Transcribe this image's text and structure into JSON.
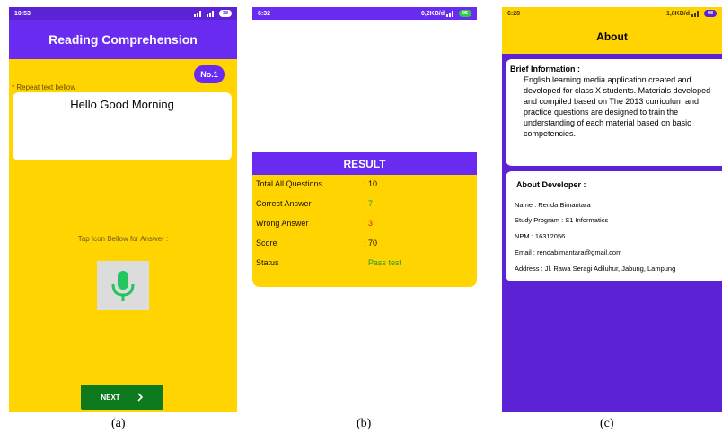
{
  "phone_a": {
    "status": {
      "time": "10:53",
      "battery": "38"
    },
    "title": "Reading Comprehension",
    "badge": "No.1",
    "hint": "* Repeat text bellow",
    "text": "Hello Good Morning",
    "tap_label": "Tap Icon Bellow for Answer :",
    "next_label": "NEXT",
    "icons": {
      "mic": "microphone-icon",
      "next": "chevron-right-icon"
    },
    "colors": {
      "accent": "#6a2bf0",
      "background": "#ffd400",
      "mic": "#22c55e",
      "next": "#0d7a1e"
    }
  },
  "phone_b": {
    "status": {
      "time": "6:32",
      "speed": "0,2KB/d",
      "battery": "95"
    },
    "result_title": "RESULT",
    "rows": [
      {
        "label": "Total All Questions",
        "value": ": 10",
        "color": "#1a1200"
      },
      {
        "label": "Correct Answer",
        "value": ": 7",
        "color": "#1d9b2e"
      },
      {
        "label": "Wrong Answer",
        "value": ": 3",
        "color": "#e02020"
      },
      {
        "label": "Score",
        "value": ": 70",
        "color": "#1a1200"
      },
      {
        "label": "Status",
        "value": ": Pass test",
        "color": "#1d9b2e"
      }
    ]
  },
  "phone_c": {
    "status": {
      "time": "6:28",
      "speed": "1,8KB/d",
      "battery": "98"
    },
    "title": "About",
    "brief_title": "Brief Information :",
    "brief_text": "English learning media application created and developed for class X students. Materials developed and compiled based on The 2013 curriculum and practice questions are designed to train the understanding of each material based on basic competencies.",
    "dev_title": "About Developer :",
    "dev_lines": [
      "Name : Renda Bimantara",
      "Study Program : S1 Informatics",
      "NPM : 16312056",
      "Email : rendabimantara@gmail.com",
      "Address : Jl. Rawa Seragi Adiluhur, Jabung, Lampung"
    ]
  },
  "captions": [
    "(a)",
    "(b)",
    "(c)"
  ]
}
